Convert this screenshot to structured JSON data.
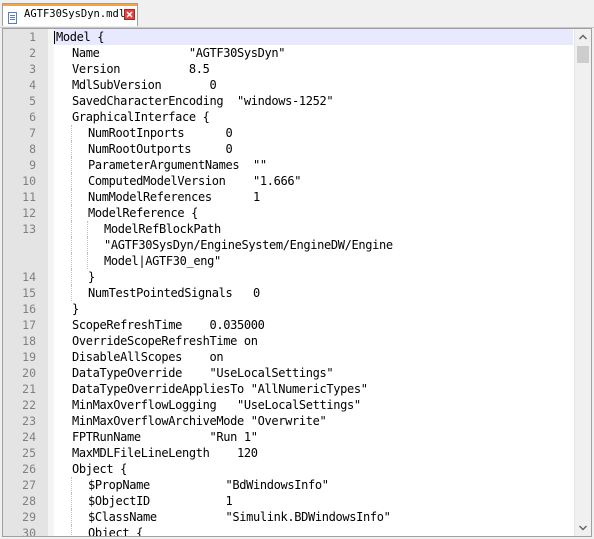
{
  "tab": {
    "title": "AGTF30SysDyn.mdl",
    "icon": "file-icon",
    "close_icon": "close-icon",
    "accent_color": "#f7a23b"
  },
  "editor": {
    "current_line": 1,
    "lines": [
      {
        "n": "1",
        "indent": 0,
        "text": "Model {"
      },
      {
        "n": "2",
        "indent": 1,
        "text": "Name             \"AGTF30SysDyn\""
      },
      {
        "n": "3",
        "indent": 1,
        "text": "Version          8.5"
      },
      {
        "n": "4",
        "indent": 1,
        "text": "MdlSubVersion       0"
      },
      {
        "n": "5",
        "indent": 1,
        "text": "SavedCharacterEncoding  \"windows-1252\""
      },
      {
        "n": "6",
        "indent": 1,
        "text": "GraphicalInterface {"
      },
      {
        "n": "7",
        "indent": 2,
        "text": "NumRootInports      0"
      },
      {
        "n": "8",
        "indent": 2,
        "text": "NumRootOutports     0"
      },
      {
        "n": "9",
        "indent": 2,
        "text": "ParameterArgumentNames  \"\""
      },
      {
        "n": "10",
        "indent": 2,
        "text": "ComputedModelVersion    \"1.666\""
      },
      {
        "n": "11",
        "indent": 2,
        "text": "NumModelReferences      1"
      },
      {
        "n": "12",
        "indent": 2,
        "text": "ModelReference {"
      },
      {
        "n": "13",
        "indent": 3,
        "text": "ModelRefBlockPath"
      },
      {
        "n": "",
        "indent": 3,
        "text": "\"AGTF30SysDyn/EngineSystem/EngineDW/Engine"
      },
      {
        "n": "",
        "indent": 3,
        "text": "Model|AGTF30_eng\""
      },
      {
        "n": "14",
        "indent": 2,
        "text": "}"
      },
      {
        "n": "15",
        "indent": 2,
        "text": "NumTestPointedSignals   0"
      },
      {
        "n": "16",
        "indent": 1,
        "text": "}"
      },
      {
        "n": "17",
        "indent": 1,
        "text": "ScopeRefreshTime    0.035000"
      },
      {
        "n": "18",
        "indent": 1,
        "text": "OverrideScopeRefreshTime on"
      },
      {
        "n": "19",
        "indent": 1,
        "text": "DisableAllScopes    on"
      },
      {
        "n": "20",
        "indent": 1,
        "text": "DataTypeOverride    \"UseLocalSettings\""
      },
      {
        "n": "21",
        "indent": 1,
        "text": "DataTypeOverrideAppliesTo \"AllNumericTypes\""
      },
      {
        "n": "22",
        "indent": 1,
        "text": "MinMaxOverflowLogging   \"UseLocalSettings\""
      },
      {
        "n": "23",
        "indent": 1,
        "text": "MinMaxOverflowArchiveMode \"Overwrite\""
      },
      {
        "n": "24",
        "indent": 1,
        "text": "FPTRunName          \"Run 1\""
      },
      {
        "n": "25",
        "indent": 1,
        "text": "MaxMDLFileLineLength    120"
      },
      {
        "n": "26",
        "indent": 1,
        "text": "Object {"
      },
      {
        "n": "27",
        "indent": 2,
        "text": "$PropName           \"BdWindowsInfo\""
      },
      {
        "n": "28",
        "indent": 2,
        "text": "$ObjectID           1"
      },
      {
        "n": "29",
        "indent": 2,
        "text": "$ClassName          \"Simulink.BDWindowsInfo\""
      },
      {
        "n": "30",
        "indent": 2,
        "text": "Object {"
      }
    ]
  },
  "scrollbar": {
    "up_icon": "chevron-up-icon",
    "down_icon": "chevron-down-icon"
  }
}
